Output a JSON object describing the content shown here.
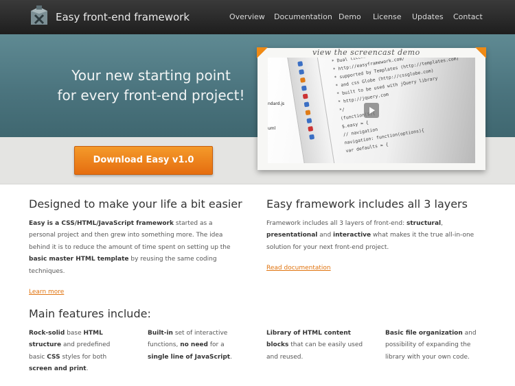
{
  "header": {
    "brand": "Easy front-end framework",
    "nav": [
      "Overview",
      "Documentation",
      "Demo",
      "License",
      "Updates",
      "Contact"
    ]
  },
  "hero": {
    "title_line1": "Your new starting point",
    "title_line2": "for every front-end project!",
    "download_label": "Download Easy v1.0",
    "screencast_caption": "view the screencast demo",
    "code_lines": [
      "* Dual licensed:",
      "* http://easyframework.com/",
      "* supported by Templates (http://templates.com)",
      "* and css Globe (http://cssglobe.com)",
      "* built to be used with jQuery library",
      "* http://jquery.com",
      "*/",
      "(function($){",
      "  $.easy = {",
      "    // navigation",
      "    navigation: function(options){",
      "      var defaults = {"
    ],
    "file_labels": [
      "ndard.js",
      "uml"
    ]
  },
  "left": {
    "heading": "Designed to make your life a bit easier",
    "p1_bold": "Easy is a CSS/HTML/JavaScript framework",
    "p1_rest": " started as a personal project and then grew into something more. The idea behind it is to reduce the amount of time spent on setting up the ",
    "p1_bold2": "basic master HTML template",
    "p1_end": " by reusing the same coding techniques.",
    "link": "Learn more"
  },
  "right": {
    "heading": "Easy framework includes all 3 layers",
    "p_a": "Framework includes all 3 layers of front-end: ",
    "p_b1": "structural",
    "p_c": ", ",
    "p_b2": "presentational",
    "p_d": " and ",
    "p_b3": "interactive",
    "p_e": " what makes it the true all-in-one solution for your next front-end project.",
    "link": "Read documentation"
  },
  "features": {
    "heading": "Main features include:",
    "f1_b1": "Rock-solid",
    "f1_t1": " base ",
    "f1_b2": "HTML structure",
    "f1_t2": " and predefined basic ",
    "f1_b3": "CSS",
    "f1_t3": " styles for both ",
    "f1_b4": "screen and print",
    "f1_t4": ".",
    "f2_b1": "Built-in",
    "f2_t1": " set of interactive functions, ",
    "f2_b2": "no need",
    "f2_t2": " for a ",
    "f2_b3": "single line of JavaScript",
    "f2_t3": ".",
    "f3_b1": "Library of HTML content blocks",
    "f3_t1": " that can be easily used and reused.",
    "f4_b1": "Basic file organization",
    "f4_t1": " and possibility of expanding the library with your own code."
  },
  "colors": {
    "accent": "#e56d10",
    "link": "#e0730e",
    "hero": "#4b747e",
    "header": "#262626"
  }
}
